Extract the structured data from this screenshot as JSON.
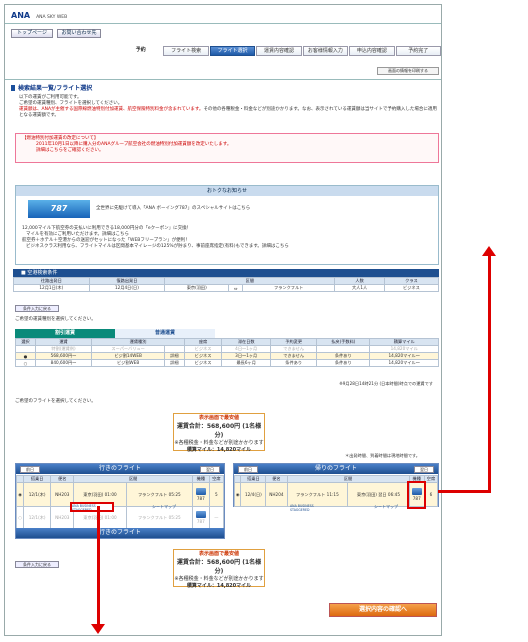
{
  "header": {
    "logo": "ANA",
    "site": "ANA SKY WEB",
    "top_btn": "トップページ",
    "contact_btn": "お問い合わせ先"
  },
  "steps": [
    "予約",
    "フライト検索",
    "フライト選択",
    "運賃内容確認",
    "お客様情報入力",
    "申込内容確認",
    "予約完了"
  ],
  "print_btn": "画面の情報を印刷する",
  "page_title": "検索結果一覧/フライト選択",
  "intro": [
    "以下の運賃がご利用可能です。",
    "ご希望の運賃種別、フライトを選択してください。"
  ],
  "intro_red": "運賃額は、ANAが主催する国際線燃油特別付加運賃、航空保険特別料金が含まれています。",
  "intro_rest": "その他の各種税金・料金などが別途かかります。なお、表示されている運賃額は当サイトで予約購入した場合に適用となる運賃額です。",
  "warn": {
    "title": "【燃油特別付加運賃の改定について】",
    "line1": "2011年10月1日以降に購入分のANAグループ航空会社の燃油特別付加運賃額を改定いたします。",
    "line2": "詳細はこちらをご確認ください。"
  },
  "news": {
    "header": "おトクなお知らせ",
    "banner": "787",
    "line1": "全世界に先駆けて導入「ANA ボーイング787」のスペシャルサイトはこちら",
    "b1": "12,000マイル下航空券の支払いに利用できる18,000円分の「eクーポン」に交換！",
    "b1b": "マイルを有効にご利用いただけます。詳細はこちら",
    "b2": "航空券＋ホテル＋空港からの送迎がセットになった「WEBフリープラン」が便利！",
    "b2b": "ビジネスクラス利用なら、フライトマイルは区間基本マイレージの125%が貯まり、事前座席指定(有料)もできます。詳細はこちら"
  },
  "cond": {
    "header": "■ 空港検索条件",
    "cols": [
      "往路出発日",
      "復路出発日",
      "区間",
      "",
      "人数",
      "クラス"
    ],
    "row": [
      "12月1日(木)",
      "12月4日(日)",
      "東京(羽田)",
      "⇔",
      "フランクフルト",
      "大人1人",
      "ビジネス"
    ]
  },
  "change_btn": "条件入力に戻る",
  "fare_prompt": "ご希望の運賃種別を選択してください。",
  "fare_tabs": [
    "割引運賃",
    "普通運賃"
  ],
  "fare_cols": [
    "選択",
    "運賃",
    "運賃種別",
    "",
    "座席",
    "滞在日数",
    "予約変更",
    "払戻(手数料)",
    "積算マイル"
  ],
  "fare_rows": [
    [
      "",
      "特割(運賃例)",
      "スーパーバリュー",
      "",
      "ビジネス",
      "4日〜1ヶ月",
      "できません",
      "",
      "14,820マイル"
    ],
    [
      "●",
      "568,600円〜",
      "ビジ割14WEB",
      "詳細",
      "ビジネス",
      "3日〜1ヶ月",
      "できません",
      "条件あり",
      "14,820マイル〜"
    ],
    [
      "○",
      "840,600円〜",
      "ビジ割WEB",
      "詳細",
      "ビジネス",
      "最長6ヶ月",
      "条件あり",
      "条件あり",
      "14,820マイル〜"
    ]
  ],
  "fare_note": "※9月28日14時21分 (日本時間)時点での運賃です",
  "flight_prompt": "ご希望のフライトを選択してください。",
  "summary": {
    "label": "表示画面で最安値",
    "fare": "運賃合計：568,600円 (1名様分)",
    "note": "※各種税金・料金などが別途かかります",
    "mile": "積算マイル：14,820マイル"
  },
  "time_note": "＊出発時間、到着時間は現地時間です。",
  "outbound": {
    "title": "行きのフライト",
    "prev": "前日",
    "next": "翌日",
    "cols": [
      "搭乗日",
      "便名",
      "区間",
      "",
      "機種",
      "空席"
    ],
    "rows": [
      [
        "12/1(木)",
        "NH203",
        "東京(羽田) 01:00",
        "フランクフルト 05:25",
        "787",
        "5"
      ],
      [
        "12/1(木)",
        "NH203",
        "東京(羽田) 01:00",
        "フランクフルト 05:25",
        "787",
        "—"
      ]
    ],
    "service": "ANA BUSINESS STAGGERED",
    "seatmap": "シートマップ"
  },
  "inbound": {
    "title": "帰りのフライト",
    "prev": "前日",
    "next": "翌日",
    "cols": [
      "搭乗日",
      "便名",
      "区間",
      "",
      "機種",
      "空席"
    ],
    "rows": [
      [
        "12/4(日)",
        "NH204",
        "フランクフルト 11:15",
        "東京(羽田) 翌日 06:45",
        "787",
        "6"
      ]
    ],
    "service": "ANA BUSINESS STAGGERED",
    "seatmap": "シートマップ"
  },
  "confirm_btn": "選択内容の確認へ",
  "colors": {
    "accent": "#1e4f90",
    "warning": "#c00",
    "highlight": "#d00"
  }
}
